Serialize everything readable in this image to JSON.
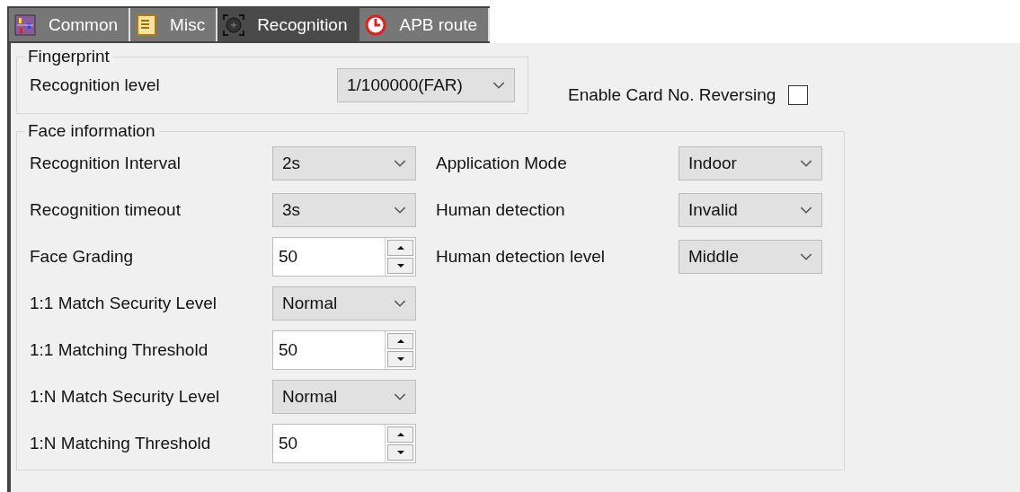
{
  "tabs": [
    {
      "label": "Common",
      "selected": false
    },
    {
      "label": "Misc",
      "selected": false
    },
    {
      "label": "Recognition",
      "selected": true
    },
    {
      "label": "APB route",
      "selected": false
    }
  ],
  "fingerprint": {
    "title": "Fingerprint",
    "label": "Recognition level",
    "value": "1/100000(FAR)"
  },
  "card_reversing": {
    "label": "Enable Card No. Reversing",
    "checked": false
  },
  "face": {
    "title": "Face information",
    "left": [
      {
        "label": "Recognition Interval",
        "kind": "dropdown",
        "value": "2s"
      },
      {
        "label": "Recognition timeout",
        "kind": "dropdown",
        "value": "3s"
      },
      {
        "label": "Face Grading",
        "kind": "spinner",
        "value": "50"
      },
      {
        "label": "1:1 Match Security Level",
        "kind": "dropdown",
        "value": "Normal"
      },
      {
        "label": "1:1 Matching Threshold",
        "kind": "spinner",
        "value": "50"
      },
      {
        "label": "1:N Match Security Level",
        "kind": "dropdown",
        "value": "Normal"
      },
      {
        "label": "1:N Matching Threshold",
        "kind": "spinner",
        "value": "50"
      }
    ],
    "right": [
      {
        "label": "Application Mode",
        "kind": "dropdown",
        "value": "Indoor"
      },
      {
        "label": "Human detection",
        "kind": "dropdown",
        "value": "Invalid"
      },
      {
        "label": "Human detection level",
        "kind": "dropdown",
        "value": "Middle"
      }
    ]
  }
}
